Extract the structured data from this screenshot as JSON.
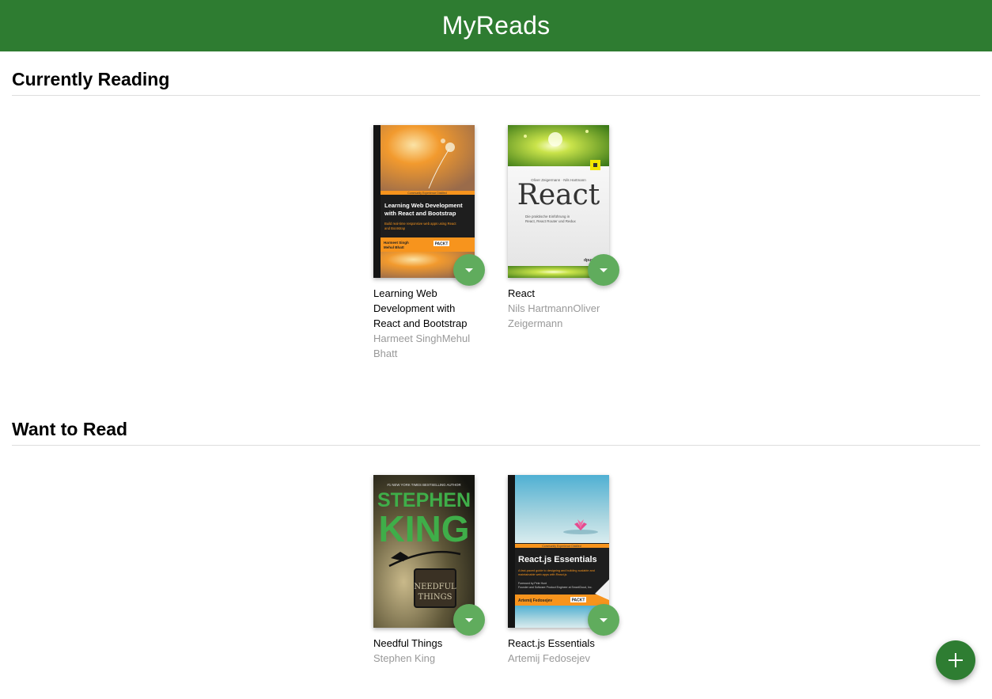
{
  "header": {
    "title": "MyReads"
  },
  "shelves": [
    {
      "title": "Currently Reading",
      "books": [
        {
          "title": "Learning Web Development with React and Bootstrap",
          "authors": "Harmeet SinghMehul Bhatt",
          "cover": {
            "series": "Community Experience Distilled",
            "heading": "Learning Web Development with React and Bootstrap",
            "subtitle": "Build real-time responsive web apps using React and Bootstrap",
            "authors": "Harmeet Singh\nMehul Bhatt",
            "publisher": "PACKT"
          }
        },
        {
          "title": "React",
          "authors": "Nils HartmannOliver Zeigermann",
          "cover": {
            "cover_authors": "Oliver Zeigermann · Nils Hartmann",
            "heading": "React",
            "subtitle": "Die praktische Einführung in React, React Router und Redux",
            "publisher": "dpunkt"
          }
        }
      ]
    },
    {
      "title": "Want to Read",
      "books": [
        {
          "title": "Needful Things",
          "authors": "Stephen King",
          "cover": {
            "tagline": "#1 NEW YORK TIMES BESTSELLING AUTHOR",
            "author_line1": "STEPHEN",
            "author_line2": "KING",
            "sign_line1": "NEEDFUL",
            "sign_line2": "THINGS"
          }
        },
        {
          "title": "React.js Essentials",
          "authors": "Artemij Fedosejev",
          "cover": {
            "series": "Community Experience Distilled",
            "heading": "React.js Essentials",
            "subtitle": "A fast-paced guide to designing and building scalable and maintainable web apps with React.js",
            "foreword": "Foreword by Pete Hunt\nFounder and Software Product Engineer at SmartCloud, Inc.",
            "authors": "Artemij Fedosejev",
            "publisher": "PACKT"
          }
        }
      ]
    }
  ],
  "fab": {
    "icon": "plus-icon",
    "color": "#2e7d32"
  },
  "colors": {
    "header": "#2e7c31",
    "changer": "#60ac5d",
    "author_text": "#999999"
  }
}
